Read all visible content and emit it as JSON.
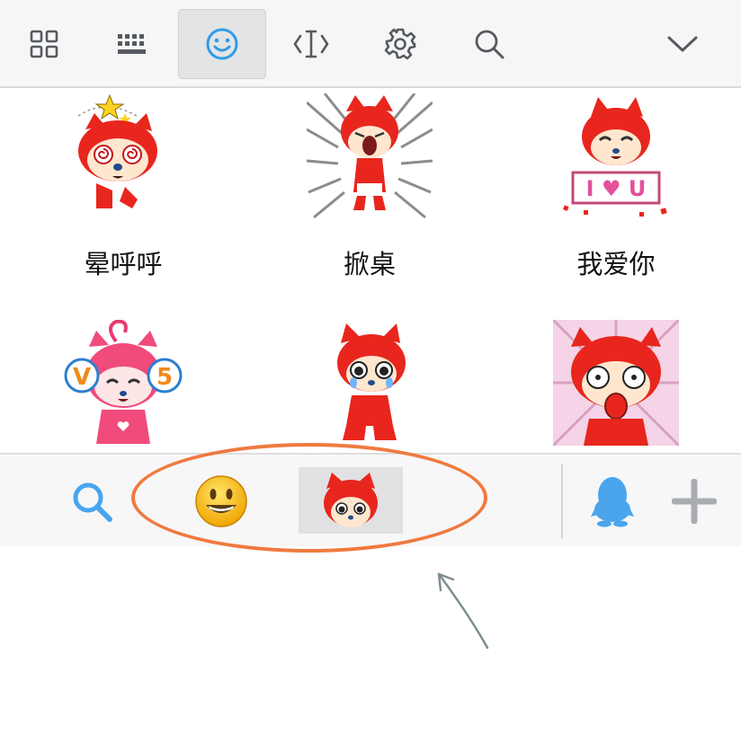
{
  "toolbar": {
    "buttons": [
      {
        "icon": "grid-icon"
      },
      {
        "icon": "keyboard-icon"
      },
      {
        "icon": "emoji-icon",
        "active": true
      },
      {
        "icon": "text-cursor-icon"
      },
      {
        "icon": "gear-icon"
      },
      {
        "icon": "search-icon"
      },
      {
        "icon": "chevron-down-icon"
      }
    ],
    "accent": "#2f9be8",
    "icon_color": "#555a60"
  },
  "stickers": [
    {
      "label": "晕呼呼",
      "icon": "dizzy-fox-sticker"
    },
    {
      "label": "掀桌",
      "icon": "table-flip-fox-sticker"
    },
    {
      "label": "我爱你",
      "icon": "i-love-you-fox-sticker"
    },
    {
      "label": "",
      "icon": "v5-fox-sticker"
    },
    {
      "label": "",
      "icon": "crying-fox-sticker"
    },
    {
      "label": "",
      "icon": "shocked-fox-sticker"
    }
  ],
  "category_bar": {
    "items": [
      {
        "icon": "search-icon"
      },
      {
        "icon": "smiley-emoji-icon"
      },
      {
        "icon": "fox-sticker-pack-icon",
        "selected": true
      },
      {
        "icon": "qq-penguin-icon"
      },
      {
        "icon": "plus-icon"
      }
    ],
    "highlight_color": "#ef7a3f"
  },
  "sticker_text": {
    "love_sign": "I ♥ U",
    "v5_left": "V",
    "v5_right": "5"
  }
}
